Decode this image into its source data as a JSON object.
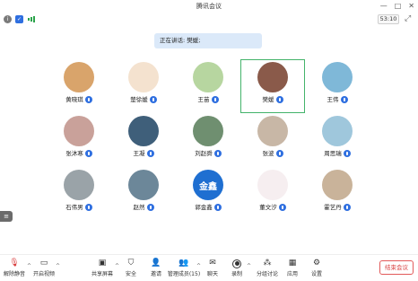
{
  "window": {
    "title": "腾讯会议"
  },
  "status": {
    "timer": "53:10"
  },
  "speaker": {
    "text": "正在讲话: 樊媛;"
  },
  "participants": [
    {
      "name": "黄晓琪",
      "muted": false,
      "avatar_bg": "#d9a46b"
    },
    {
      "name": "楚徐媛",
      "muted": false,
      "avatar_bg": "#f4e2cf"
    },
    {
      "name": "王苗",
      "muted": false,
      "avatar_bg": "#b7d6a0"
    },
    {
      "name": "樊媛",
      "muted": false,
      "avatar_bg": "#8a5a4a",
      "highlight": true
    },
    {
      "name": "王伟",
      "muted": false,
      "avatar_bg": "#7fb8d8"
    },
    {
      "name": "张沐寒",
      "muted": false,
      "avatar_bg": "#c9a19a"
    },
    {
      "name": "王凝",
      "muted": false,
      "avatar_bg": "#3f5f7a"
    },
    {
      "name": "刘赵舜",
      "muted": false,
      "avatar_bg": "#6f8f70"
    },
    {
      "name": "张波",
      "muted": false,
      "avatar_bg": "#c8b7a6"
    },
    {
      "name": "周思瑞",
      "muted": false,
      "avatar_bg": "#9fc7dc"
    },
    {
      "name": "石伟男",
      "muted": false,
      "avatar_bg": "#9aa3a8"
    },
    {
      "name": "赵然",
      "muted": false,
      "avatar_bg": "#6c8799"
    },
    {
      "name": "郭金鑫",
      "muted": false,
      "avatar_bg": "#1f6fd1",
      "avatar_text": "金鑫"
    },
    {
      "name": "董文汐",
      "muted": false,
      "avatar_bg": "#f6eef0"
    },
    {
      "name": "霍艺丹",
      "muted": false,
      "avatar_bg": "#c9b39a"
    }
  ],
  "toolbar": {
    "unmute": "解除静音",
    "video": "开启视频",
    "share": "共享屏幕",
    "security": "安全",
    "invite": "邀请",
    "members": "管理成员(15)",
    "chat": "聊天",
    "record": "录制",
    "breakout": "分组讨论",
    "apps": "应用",
    "settings": "设置",
    "end": "结束会议"
  },
  "colors": {
    "accent": "#2f6fe0",
    "highlight": "#43b36a",
    "danger": "#d83c3c"
  }
}
